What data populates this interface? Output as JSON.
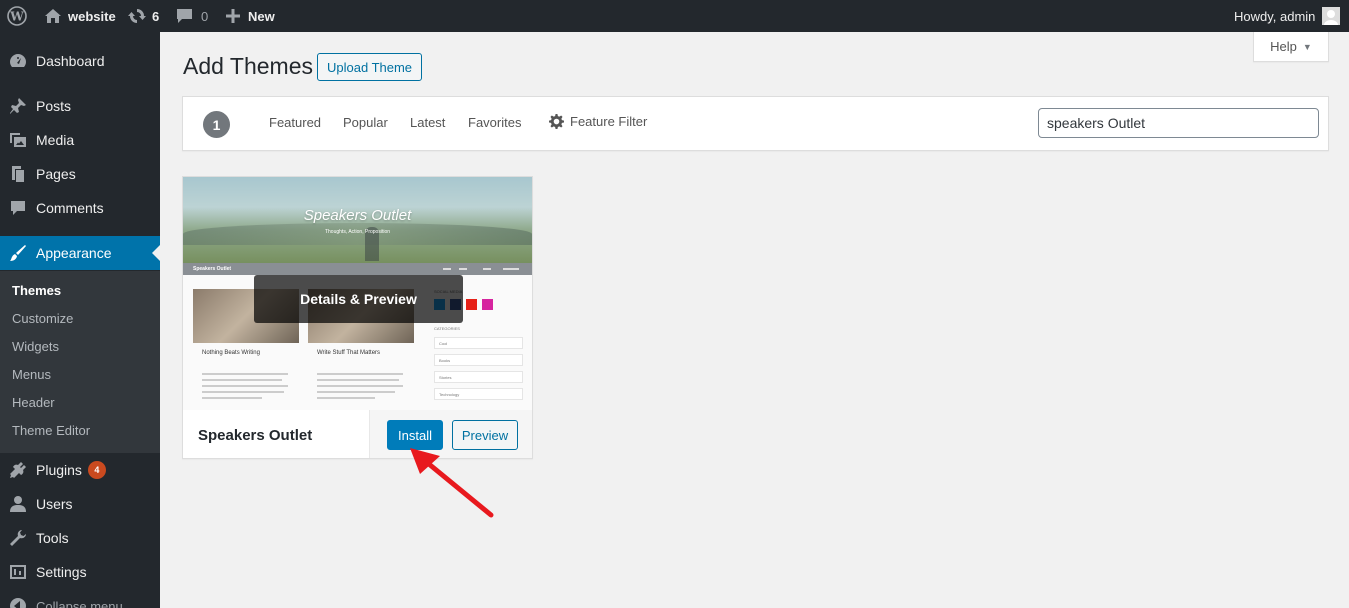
{
  "adminbar": {
    "site_name": "website",
    "updates_count": "6",
    "comments_count": "0",
    "new_label": "New",
    "howdy": "Howdy, admin"
  },
  "sidebar": {
    "items": [
      {
        "label": "Dashboard",
        "icon": "dashboard-icon"
      },
      {
        "label": "Posts",
        "icon": "pin-icon"
      },
      {
        "label": "Media",
        "icon": "media-icon"
      },
      {
        "label": "Pages",
        "icon": "pages-icon"
      },
      {
        "label": "Comments",
        "icon": "comment-icon"
      },
      {
        "label": "Appearance",
        "icon": "brush-icon"
      },
      {
        "label": "Plugins",
        "icon": "plugin-icon",
        "badge": "4"
      },
      {
        "label": "Users",
        "icon": "users-icon"
      },
      {
        "label": "Tools",
        "icon": "wrench-icon"
      },
      {
        "label": "Settings",
        "icon": "settings-icon"
      },
      {
        "label": "Collapse menu",
        "icon": "collapse-icon"
      }
    ],
    "submenu": [
      "Themes",
      "Customize",
      "Widgets",
      "Menus",
      "Header",
      "Theme Editor"
    ]
  },
  "help": {
    "label": "Help"
  },
  "page": {
    "title": "Add Themes",
    "upload_label": "Upload Theme"
  },
  "filter": {
    "count": "1",
    "links": [
      "Featured",
      "Popular",
      "Latest",
      "Favorites"
    ],
    "feature_filter": "Feature Filter",
    "search_value": "speakers Outlet"
  },
  "theme": {
    "name": "Speakers Outlet",
    "details_label": "Details & Preview",
    "install_label": "Install",
    "preview_label": "Preview",
    "screenshot": {
      "hero_title": "Speakers Outlet",
      "hero_subtitle": "Thoughts, Action, Proposition",
      "nav_brand": "Speakers Outlet",
      "post1_title": "Nothing Beats Writing",
      "post2_title": "Write Stuff That Matters",
      "widget1_title": "SOCIAL MEDIA",
      "widget2_title": "CATEGORIES",
      "categories": [
        "Cool",
        "Books",
        "Stories",
        "Technology"
      ]
    }
  },
  "colors": {
    "adminbar_bg": "#23282d",
    "accent": "#0073aa",
    "install_bg": "#007cba",
    "badge": "#ca4a1f",
    "annotation_arrow": "#e8191e"
  }
}
